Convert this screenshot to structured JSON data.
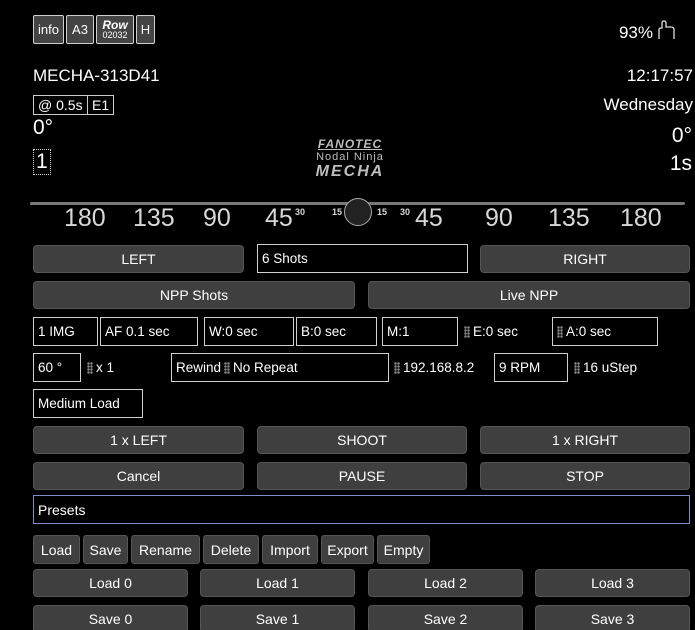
{
  "topbar": {
    "info": "info",
    "a3": "A3",
    "row_label": "Row",
    "row_value": "02032",
    "h": "H",
    "battery": "93%"
  },
  "status": {
    "device": "MECHA-313D41",
    "time": "12:17:57",
    "interval": "@ 0.5s",
    "e1": "E1",
    "day": "Wednesday",
    "angle_left": "0°",
    "angle_right": "0°",
    "count": "1",
    "duration": "1s"
  },
  "logo": {
    "brand": "FANOTEC",
    "line2": "Nodal Ninja",
    "line3": "MECHA"
  },
  "ruler": {
    "ticks": [
      "180",
      "135",
      "90",
      "45",
      "45",
      "90",
      "135",
      "180"
    ],
    "small": [
      "30",
      "15",
      "15",
      "30"
    ]
  },
  "controls": {
    "left": "LEFT",
    "shots": "6 Shots",
    "right": "RIGHT",
    "npp_shots": "NPP Shots",
    "live_npp": "Live NPP"
  },
  "params": {
    "img": "1 IMG",
    "af": "AF 0.1 sec",
    "w": "W:0 sec",
    "b": "B:0 sec",
    "m": "M:1",
    "e": "E:0 sec",
    "a": "A:0 sec",
    "angle": "60 °",
    "mult": "x 1",
    "rewind": "Rewind",
    "repeat": "No Repeat",
    "ip": "192.168.8.2",
    "rpm": "9 RPM",
    "ustep": "16 uStep",
    "load": "Medium Load"
  },
  "actions": {
    "left1": "1 x LEFT",
    "shoot": "SHOOT",
    "right1": "1 x RIGHT",
    "cancel": "Cancel",
    "pause": "PAUSE",
    "stop": "STOP"
  },
  "presets": {
    "title": "Presets",
    "buttons": [
      "Load",
      "Save",
      "Rename",
      "Delete",
      "Import",
      "Export",
      "Empty"
    ],
    "load": [
      "Load 0",
      "Load 1",
      "Load 2",
      "Load 3"
    ],
    "save": [
      "Save 0",
      "Save 1",
      "Save 2",
      "Save 3"
    ]
  },
  "colors": {
    "background": "#000000",
    "button": "#3f3f3f",
    "presets_border": "#7e8fc4"
  }
}
